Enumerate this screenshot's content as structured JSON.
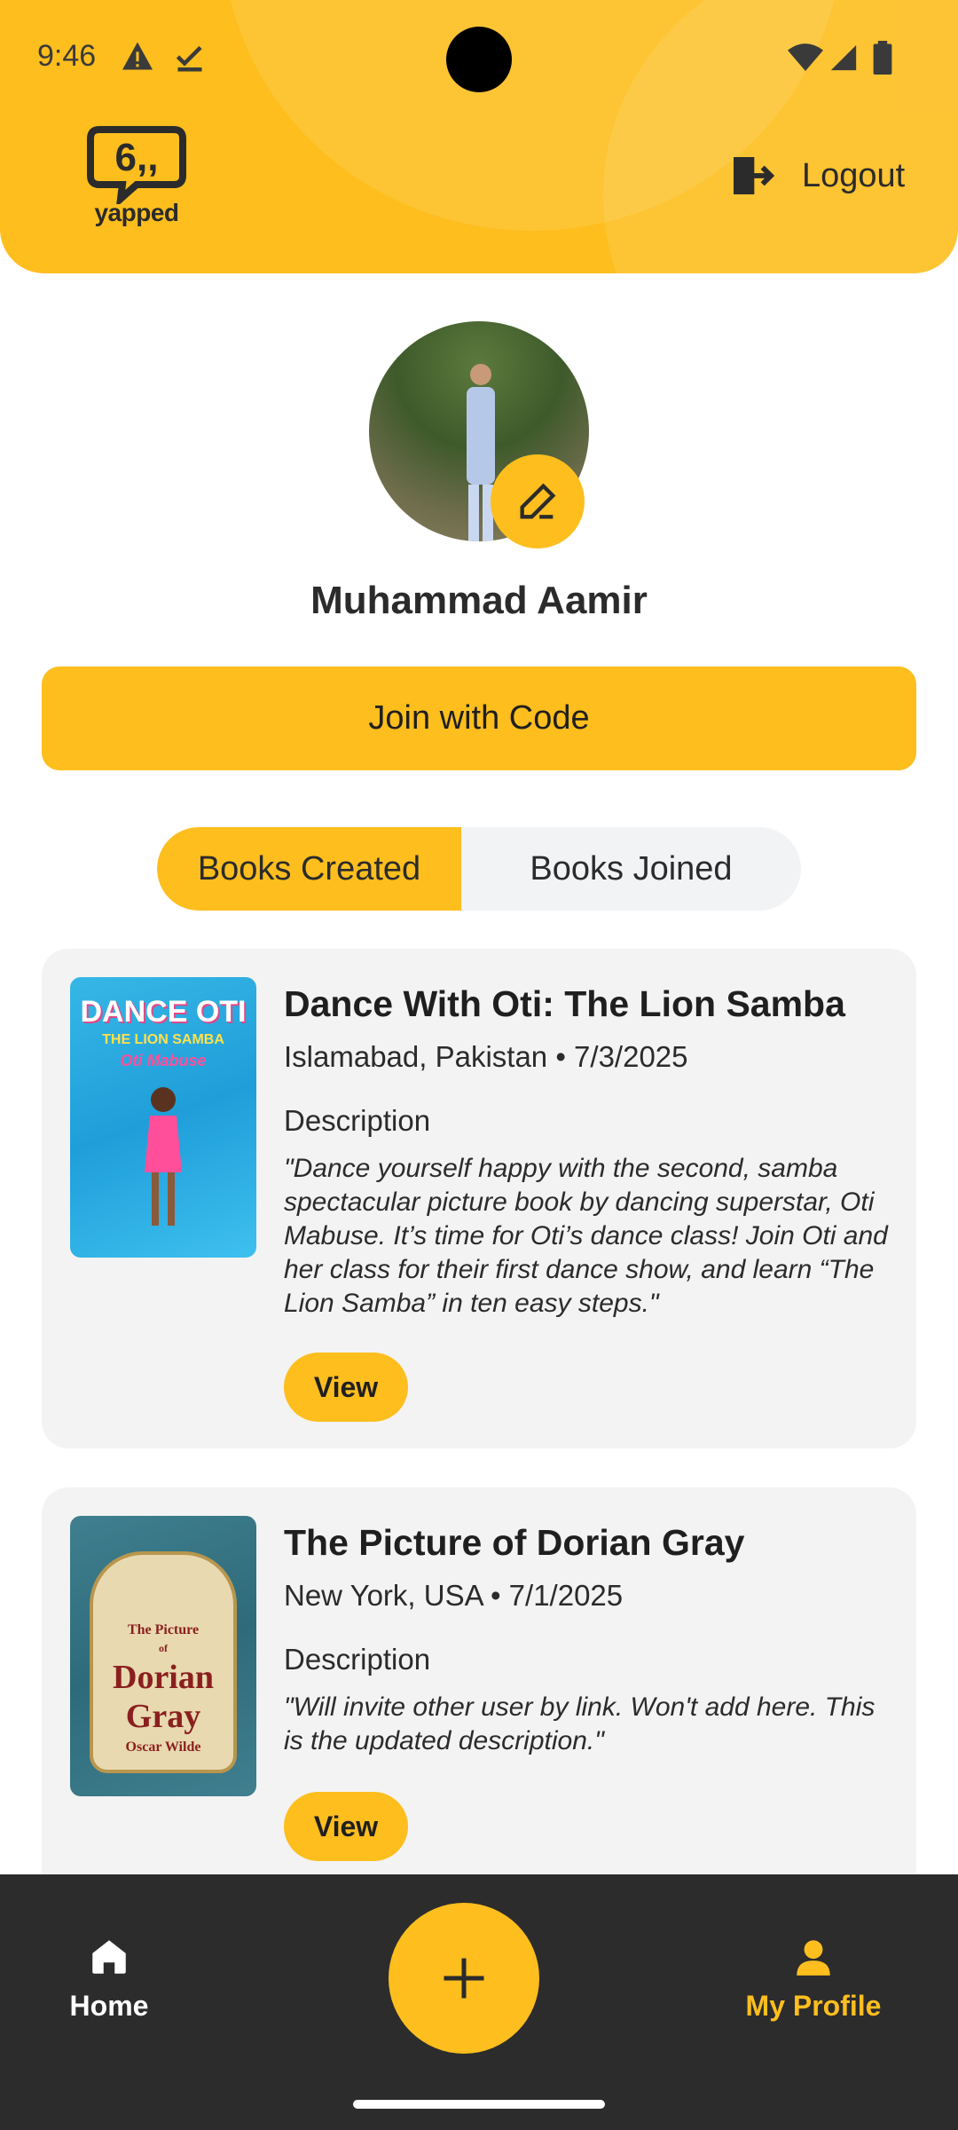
{
  "status_bar": {
    "time": "9:46",
    "icons": [
      "warning-icon",
      "download-check-icon",
      "wifi-icon",
      "signal-icon",
      "battery-icon"
    ]
  },
  "header": {
    "logo_text": "yapped",
    "logout_label": "Logout"
  },
  "profile": {
    "name": "Muhammad Aamir",
    "edit_icon": "pencil-icon"
  },
  "join_button": {
    "label": "Join with Code"
  },
  "tabs": [
    {
      "label": "Books Created",
      "active": true
    },
    {
      "label": "Books Joined",
      "active": false
    }
  ],
  "books": [
    {
      "title": "Dance With Oti: The Lion Samba",
      "meta": "Islamabad, Pakistan • 7/3/2025",
      "description_label": "Description",
      "description": "\"Dance yourself happy with the second, samba spectacular picture book by dancing superstar, Oti Mabuse. It’s time for Oti’s dance class! Join Oti and her class for their first dance show, and learn “The Lion Samba” in ten easy steps.\"",
      "view_label": "View",
      "cover_text": {
        "title": "DANCE OTI",
        "subtitle": "THE LION SAMBA",
        "author": "Oti Mabuse"
      }
    },
    {
      "title": "The Picture of Dorian Gray",
      "meta": "New York, USA • 7/1/2025",
      "description_label": "Description",
      "description": "\"Will invite other user by link. Won't add here. This is the updated description.\"",
      "view_label": "View",
      "cover_text": {
        "line1": "The Picture",
        "line2": "of",
        "line3": "Dorian",
        "line4": "Gray",
        "author": "Oscar Wilde"
      }
    }
  ],
  "bottom_nav": {
    "home_label": "Home",
    "profile_label": "My Profile",
    "fab_icon": "plus-icon"
  },
  "colors": {
    "accent": "#FDBE1E",
    "nav_background": "#2C2C2C",
    "card_background": "#F3F3F3"
  }
}
